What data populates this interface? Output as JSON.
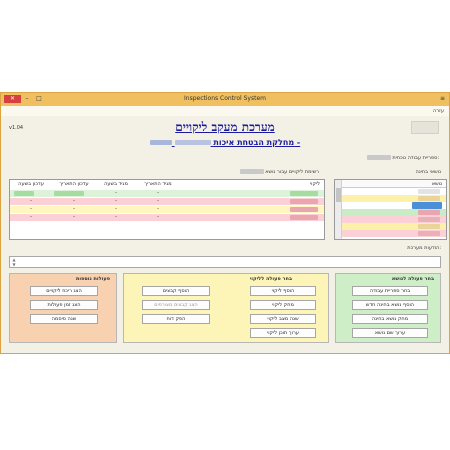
{
  "window": {
    "title": "Inspections Control System",
    "close_glyph": "✕",
    "min_glyph": "–",
    "max_glyph": "□",
    "sysmenu_glyph": "≡"
  },
  "menu": {
    "help": "עזרה"
  },
  "header": {
    "version": "v1.04",
    "main_title": "מערכת מעקב ליקויים",
    "sub_title": "מחלקת הבטחת איכות -",
    "teams_label": "ספריית עבודה נוכחית:"
  },
  "subjects": {
    "label": "נושאי בחינה",
    "column": "נושא",
    "rows": [
      {
        "bg": "#ffffff",
        "blur": "#e3e3e3"
      },
      {
        "bg": "#fdf0a8",
        "blur": "#ead49c"
      },
      {
        "bg": "#ffffff",
        "blur": "#4a8fd8",
        "selected": true
      },
      {
        "bg": "#c8ecc6",
        "blur": "#e9a5b0"
      },
      {
        "bg": "#fbd0d6",
        "blur": "#eab0b8"
      },
      {
        "bg": "#fdf0a8",
        "blur": "#ead49c"
      },
      {
        "bg": "#fbd0d6",
        "blur": "#eab0b8"
      }
    ]
  },
  "inspections": {
    "label": "רשימת ליקויים עבור נושא",
    "columns": [
      "ליקוי",
      "מגיד התאריך",
      "מגיד בשעה",
      "עדכון התאריך",
      "עדכון בשעה"
    ],
    "rows": [
      {
        "bg": "#dcf3da",
        "c2": "-",
        "c3": "-",
        "c4": "",
        "c5": ""
      },
      {
        "bg": "#fbd0d6",
        "c2": "-",
        "c3": "-",
        "c4": "-",
        "c5": "-"
      },
      {
        "bg": "#fff6c0",
        "c2": "-",
        "c3": "-",
        "c4": "-",
        "c5": "-"
      },
      {
        "bg": "#fbd0d6",
        "c2": "-",
        "c3": "-",
        "c4": "-",
        "c5": "-"
      }
    ]
  },
  "messages": {
    "label": "הודעות מערכת:",
    "up_glyph": "▲",
    "down_glyph": "▼"
  },
  "panel_subject": {
    "title": "בחר פעולה לנושא",
    "buttons": [
      "בחר ספריית עבודה",
      "הוסף נושא בחינה חדש",
      "מחק נושא בחינה",
      "ערוך שם נושא"
    ]
  },
  "panel_defect": {
    "title": "בחר פעולה לליקוי",
    "right_buttons": [
      "הוסף ליקוי",
      "מחק ליקוי",
      "שנה מצב ליקוי",
      "ערוך תוכן ליקוי"
    ],
    "left_buttons": [
      "הוסף קבצים",
      "הצג קבצים מצורפים",
      "הפק דוח"
    ]
  },
  "panel_extra": {
    "title": "פעולות נוספות",
    "buttons": [
      "הצג ריכוז ליקויים",
      "הצג זמן פעולות",
      "שנה סיסמה"
    ]
  },
  "colors": {
    "window_border": "#d9a441",
    "titlebar": "#f0c060",
    "panel_subject_bg": "#cdeec6",
    "panel_defect_bg": "#fdf5b8",
    "panel_extra_bg": "#f8d2b0",
    "title_link": "#1a1a9c"
  }
}
